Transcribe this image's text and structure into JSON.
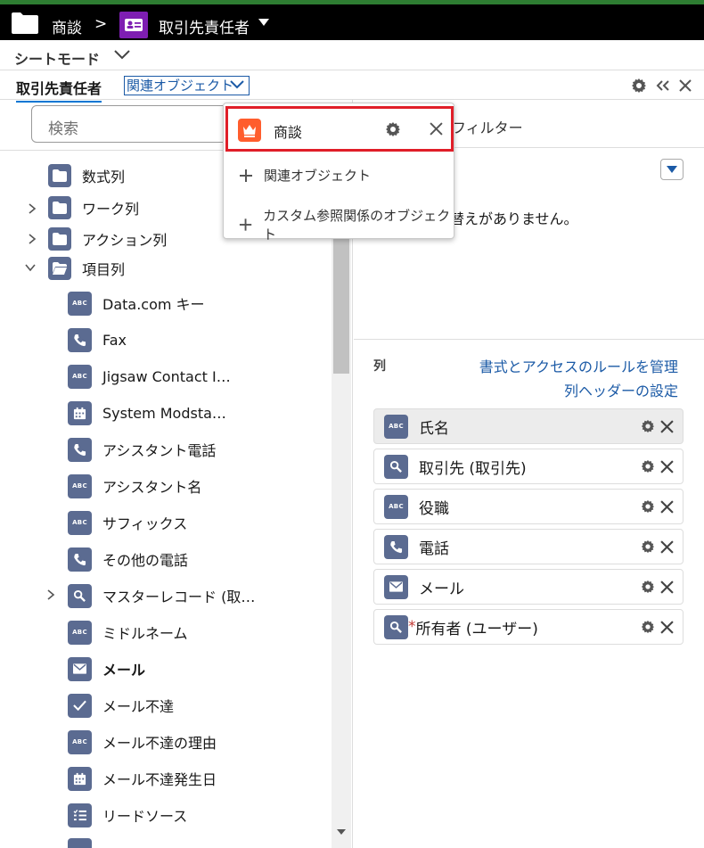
{
  "header": {
    "breadcrumb_parent": "商談",
    "separator": ">",
    "current_object": "取引先責任者",
    "badge_color": "#7e1eb2"
  },
  "sheet_mode": {
    "label": "シートモード"
  },
  "tabs": {
    "active": "取引先責任者",
    "related_objects": "関連オブジェクト"
  },
  "search": {
    "placeholder": "検索"
  },
  "tree": {
    "folders": [
      {
        "label": "数式列",
        "expanded": null
      },
      {
        "label": "ワーク列",
        "expanded": false
      },
      {
        "label": "アクション列",
        "expanded": false
      },
      {
        "label": "項目列",
        "expanded": true
      }
    ],
    "fields": [
      {
        "label": "Data.com キー",
        "icon": "abc-icon"
      },
      {
        "label": "Fax",
        "icon": "phone-icon"
      },
      {
        "label": "Jigsaw Contact I…",
        "icon": "abc-icon"
      },
      {
        "label": "System Modsta…",
        "icon": "calendar-icon"
      },
      {
        "label": "アシスタント電話",
        "icon": "phone-icon"
      },
      {
        "label": "アシスタント名",
        "icon": "abc-icon"
      },
      {
        "label": "サフィックス",
        "icon": "abc-icon"
      },
      {
        "label": "その他の電話",
        "icon": "phone-icon"
      },
      {
        "label": "マスターレコード (取…",
        "icon": "lookup-icon",
        "expandable": true
      },
      {
        "label": "ミドルネーム",
        "icon": "abc-icon"
      },
      {
        "label": "メール",
        "icon": "email-icon",
        "bold": true
      },
      {
        "label": "メール不達",
        "icon": "checkbox-icon"
      },
      {
        "label": "メール不達の理由",
        "icon": "abc-icon"
      },
      {
        "label": "メール不達発生日",
        "icon": "calendar-icon"
      },
      {
        "label": "リードソース",
        "icon": "picklist-icon"
      }
    ]
  },
  "right": {
    "filter_label": "フィルター",
    "no_change_text": "替えがありません。",
    "columns_label": "列",
    "manage_rules_link": "書式とアクセスのルールを管理",
    "column_header_settings_link": "列ヘッダーの設定",
    "columns": [
      {
        "label": "氏名",
        "icon": "abc-icon",
        "selected": true,
        "required": false
      },
      {
        "label": "取引先 (取引先)",
        "icon": "lookup-icon",
        "selected": false,
        "required": false
      },
      {
        "label": "役職",
        "icon": "abc-icon",
        "selected": false,
        "required": false
      },
      {
        "label": "電話",
        "icon": "phone-icon",
        "selected": false,
        "required": false
      },
      {
        "label": "メール",
        "icon": "email-icon",
        "selected": false,
        "required": false
      },
      {
        "label": "所有者 (ユーザー)",
        "icon": "lookup-icon",
        "selected": false,
        "required": true,
        "required_mark": "*"
      }
    ]
  },
  "popup": {
    "highlighted_item": "商談",
    "add_related_object": "関連オブジェクト",
    "add_custom_lookup": "カスタム参照関係のオブジェクト",
    "highlight_color": "#e01e28",
    "opportunity_icon_color": "#ff5d2d"
  },
  "colors": {
    "field_icon": "#5b6b91",
    "link": "#1b5aa6",
    "header_bg": "#000000"
  }
}
